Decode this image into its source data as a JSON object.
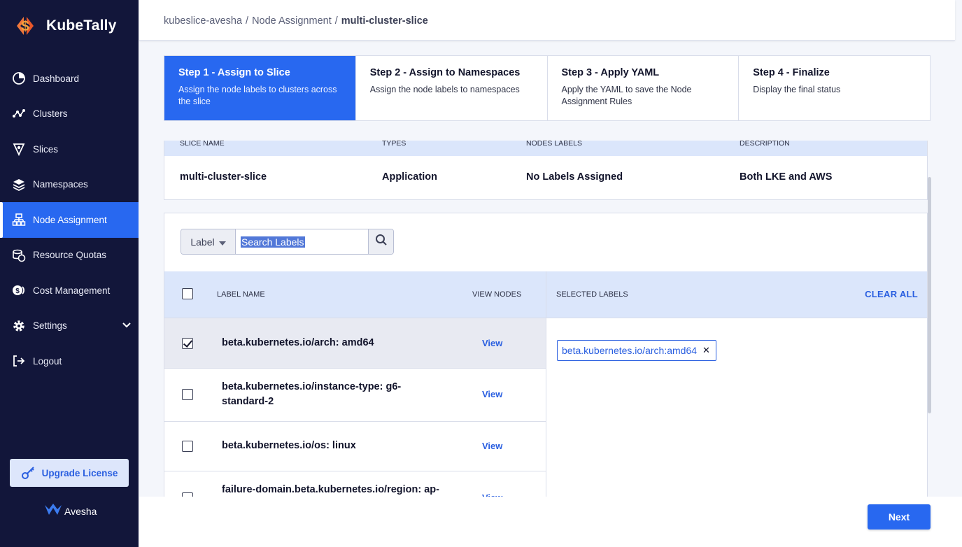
{
  "app": {
    "name": "KubeTally",
    "footer_brand": "Avesha",
    "colors": {
      "sidebar_bg": "#12163a",
      "accent": "#2868f0",
      "header_band": "#dbe6fb"
    }
  },
  "sidebar": {
    "items": [
      {
        "label": "Dashboard",
        "icon": "pie-chart-icon"
      },
      {
        "label": "Clusters",
        "icon": "nodes-icon"
      },
      {
        "label": "Slices",
        "icon": "slice-icon"
      },
      {
        "label": "Namespaces",
        "icon": "layers-icon"
      },
      {
        "label": "Node Assignment",
        "icon": "hierarchy-icon",
        "active": true
      },
      {
        "label": "Resource Quotas",
        "icon": "coins-icon"
      },
      {
        "label": "Cost Management",
        "icon": "money-icon"
      },
      {
        "label": "Settings",
        "icon": "gear-icon"
      },
      {
        "label": "Logout",
        "icon": "logout-icon"
      }
    ],
    "upgrade_label": "Upgrade License"
  },
  "breadcrumb": {
    "items": [
      "kubeslice-avesha",
      "Node Assignment"
    ],
    "current": "multi-cluster-slice",
    "separator": "/"
  },
  "stepper": {
    "steps": [
      {
        "title": "Step 1 - Assign to Slice",
        "desc": "Assign the node labels to clusters across the slice",
        "active": true
      },
      {
        "title": "Step 2 - Assign to Namespaces",
        "desc": "Assign the node labels to namespaces"
      },
      {
        "title": "Step 3 - Apply YAML",
        "desc": "Apply the YAML to save the Node Assignment Rules"
      },
      {
        "title": "Step 4 - Finalize",
        "desc": "Display the final status"
      }
    ]
  },
  "slice_summary": {
    "headers": [
      "SLICE NAME",
      "TYPES",
      "NODES LABELS",
      "DESCRIPTION"
    ],
    "values": [
      "multi-cluster-slice",
      "Application",
      "No Labels Assigned",
      "Both LKE and AWS"
    ]
  },
  "label_search": {
    "select_value": "Label",
    "placeholder": "Search Labels",
    "value": ""
  },
  "labels_table": {
    "headers": {
      "name": "LABEL NAME",
      "view": "VIEW NODES"
    },
    "rows": [
      {
        "label": "beta.kubernetes.io/arch: amd64",
        "view": "View",
        "checked": true
      },
      {
        "label": "beta.kubernetes.io/instance-type: g6-standard-2",
        "view": "View",
        "checked": false
      },
      {
        "label": "beta.kubernetes.io/os: linux",
        "view": "View",
        "checked": false
      },
      {
        "label": "failure-domain.beta.kubernetes.io/region: ap-",
        "view": "View",
        "checked": false
      }
    ]
  },
  "selected_labels": {
    "title": "SELECTED LABELS",
    "clear_label": "CLEAR ALL",
    "chips": [
      "beta.kubernetes.io/arch:amd64"
    ]
  },
  "footer": {
    "next_label": "Next"
  }
}
